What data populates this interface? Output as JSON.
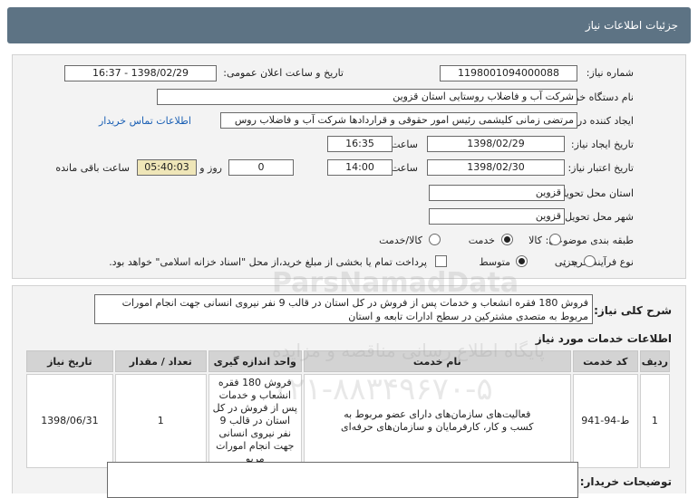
{
  "header": {
    "title": "جزئیات اطلاعات نیاز"
  },
  "form": {
    "need_number_label": "شماره نیاز:",
    "need_number": "1198001094000088",
    "announce_label": "تاریخ و ساعت اعلان عمومی:",
    "announce_value": "1398/02/29 - 16:37",
    "buyer_org_label": "نام دستگاه خریدار:",
    "buyer_org": "شرکت آب و فاضلاب روستایی استان قزوین",
    "requester_label": "ایجاد کننده درخواست:",
    "requester": "مرتضی زمانی کلیشمی رئیس امور حقوقی و قراردادها شرکت آب و فاضلاب روس",
    "contact_link": "اطلاعات تماس خریدار",
    "created_label": "تاریخ ایجاد نیاز:",
    "created_date": "1398/02/29",
    "time_label": "ساعت",
    "created_time": "16:35",
    "validity_label": "تاریخ اعتبار نیاز:",
    "validity_date": "1398/02/30",
    "validity_time": "14:00",
    "days_value": "0",
    "days_label": "روز و",
    "remaining_time": "05:40:03",
    "remaining_label": "ساعت باقی مانده",
    "province_label": "استان محل تحویل:",
    "province": "قزوین",
    "city_label": "شهر محل تحویل:",
    "city": "قزوین",
    "category_label": "طبقه بندی موضوعی:",
    "category_options": [
      "کالا",
      "خدمت",
      "کالا/خدمت"
    ],
    "category_selected": "خدمت",
    "process_label": "نوع فرآیند خرید :",
    "process_options": [
      "جزیی",
      "متوسط"
    ],
    "process_selected": "متوسط",
    "payment_note": "پرداخت تمام یا بخشی از مبلغ خرید،از محل \"اسناد خزانه اسلامی\" خواهد بود."
  },
  "description": {
    "label": "شرح کلی نیاز:",
    "text": "فروش 180 فقره انشعاب و خدمات پس از فروش در کل استان در قالب 9 نفر نیروی انسانی جهت انجام امورات مربوط به متصدی مشترکین در سطح ادارات تابعه و استان"
  },
  "services": {
    "title": "اطلاعات خدمات مورد نیاز",
    "columns": [
      "ردیف",
      "کد خدمت",
      "نام خدمت",
      "واحد اندازه گیری",
      "تعداد / مقدار",
      "تاریخ نیاز"
    ],
    "rows": [
      {
        "row": "1",
        "code": "ط-94-941",
        "name": "فعالیت‌های سازمان‌های دارای عضو مربوط به کسب و کار، کارفرمایان و سازمان‌های حرفه‌ای",
        "unit": "فروش 180 فقره انشعاب و خدمات پس از فروش در کل استان در قالب 9 نفر نیروی انسانی جهت انجام امورات مربو",
        "qty": "1",
        "date": "1398/06/31"
      }
    ]
  },
  "buyer_notes": {
    "label": "توضیحات خریدار:"
  },
  "watermark": {
    "brand": "ParsNamadData",
    "text": "پایگاه اطلاع رسانی مناقصه و مزایده",
    "phone": "۰۲۱-۸۸۳۴۹۶۷۰-۵"
  },
  "colors": {
    "header_bg": "#5d7384",
    "link": "#1a5fb4",
    "remaining_bg": "#efe6b8"
  }
}
